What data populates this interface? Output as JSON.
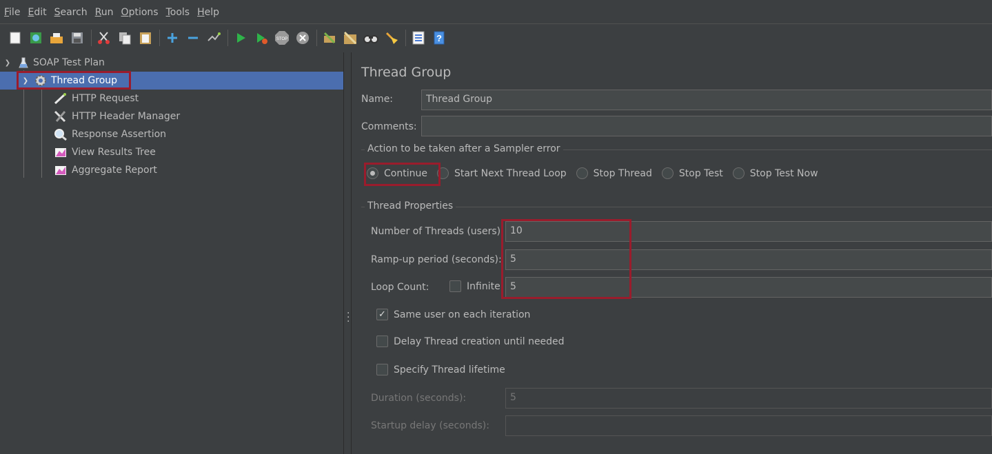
{
  "menu": {
    "items": [
      {
        "label": "File",
        "u": "F",
        "rest": "ile"
      },
      {
        "label": "Edit",
        "u": "E",
        "rest": "dit"
      },
      {
        "label": "Search",
        "u": "S",
        "rest": "earch"
      },
      {
        "label": "Run",
        "u": "R",
        "rest": "un"
      },
      {
        "label": "Options",
        "u": "O",
        "rest": "ptions"
      },
      {
        "label": "Tools",
        "u": "T",
        "rest": "ools"
      },
      {
        "label": "Help",
        "u": "H",
        "rest": "elp"
      }
    ]
  },
  "toolbar": {
    "icons": [
      "new-icon",
      "templates-icon",
      "open-icon",
      "save-icon",
      "cut-icon",
      "copy-icon",
      "paste-icon",
      "expand-icon",
      "collapse-icon",
      "toggle-icon",
      "start-icon",
      "start-no-pause-icon",
      "stop-icon",
      "shutdown-icon",
      "clear-icon",
      "clear-all-icon",
      "search-icon",
      "reset-search-icon",
      "function-helper-icon",
      "help-icon"
    ]
  },
  "tree": {
    "items": [
      {
        "label": "SOAP Test Plan",
        "icon": "test-plan-icon"
      },
      {
        "label": "Thread Group",
        "icon": "thread-group-icon"
      },
      {
        "label": "HTTP Request",
        "icon": "http-request-icon"
      },
      {
        "label": "HTTP Header Manager",
        "icon": "header-manager-icon"
      },
      {
        "label": "Response Assertion",
        "icon": "assertion-icon"
      },
      {
        "label": "View Results Tree",
        "icon": "listener-icon"
      },
      {
        "label": "Aggregate Report",
        "icon": "listener-icon"
      }
    ]
  },
  "panel": {
    "title": "Thread Group",
    "name_label": "Name:",
    "name_value": "Thread Group",
    "comments_label": "Comments:",
    "comments_value": "",
    "action_group_title": "Action to be taken after a Sampler error",
    "actions": [
      {
        "label": "Continue",
        "selected": true
      },
      {
        "label": "Start Next Thread Loop",
        "selected": false
      },
      {
        "label": "Stop Thread",
        "selected": false
      },
      {
        "label": "Stop Test",
        "selected": false
      },
      {
        "label": "Stop Test Now",
        "selected": false
      }
    ],
    "props_group_title": "Thread Properties",
    "threads_label": "Number of Threads (users):",
    "threads_value": "10",
    "rampup_label": "Ramp-up period (seconds):",
    "rampup_value": "5",
    "loop_label": "Loop Count:",
    "infinite_label": "Infinite",
    "infinite_checked": false,
    "loop_value": "5",
    "same_user_label": "Same user on each iteration",
    "same_user_checked": true,
    "delay_label": "Delay Thread creation until needed",
    "delay_checked": false,
    "lifetime_label": "Specify Thread lifetime",
    "lifetime_checked": false,
    "duration_label": "Duration (seconds):",
    "duration_value": "5",
    "startup_label": "Startup delay (seconds):",
    "startup_value": ""
  },
  "colors": {
    "background": "#3c3f41",
    "selection": "#4b6eaf",
    "highlight": "#9a1c2c",
    "text": "#bbbbbb"
  }
}
